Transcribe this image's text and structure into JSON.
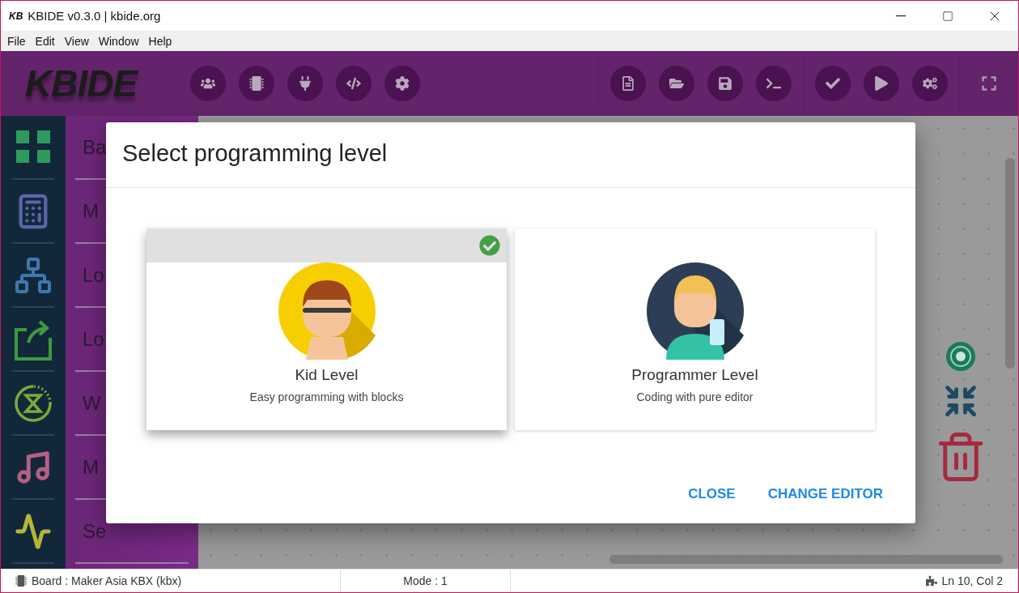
{
  "window": {
    "app_icon": "KB",
    "title": "KBIDE v0.3.0 | kbide.org"
  },
  "menu": [
    "File",
    "Edit",
    "View",
    "Window",
    "Help"
  ],
  "toolbar": {
    "logo": "KBIDE"
  },
  "categories": [
    {
      "label": "Ba"
    },
    {
      "label": "M"
    },
    {
      "label": "Lo"
    },
    {
      "label": "Lo"
    },
    {
      "label": "W"
    },
    {
      "label": "M"
    },
    {
      "label": "Se"
    }
  ],
  "dialog": {
    "title": "Select programming level",
    "options": [
      {
        "name": "Kid Level",
        "description": "Easy programming with blocks",
        "selected": true
      },
      {
        "name": "Programmer Level",
        "description": "Coding with pure editor",
        "selected": false
      }
    ],
    "buttons": [
      "CLOSE",
      "CHANGE EDITOR"
    ]
  },
  "status_bar": {
    "board": "Board : Maker Asia KBX (kbx)",
    "mode": "Mode : 1",
    "position": "Ln 10, Col 2"
  }
}
